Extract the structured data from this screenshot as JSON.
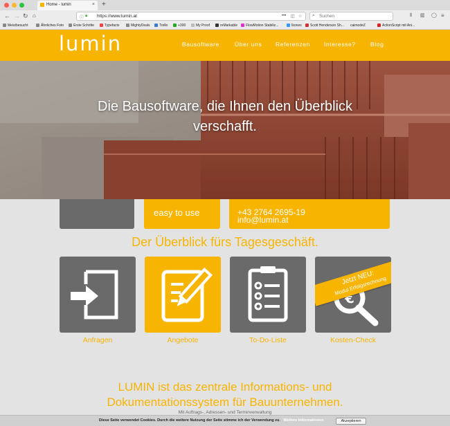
{
  "browser": {
    "tab_title": "Home - lumin",
    "tab_close": "×",
    "new_tab": "+",
    "url": "https://www.lumin.at",
    "search_placeholder": "Suchen",
    "bookmarks": [
      "Meistbesucht",
      "Ähnliches Foto",
      "Erste Schritte",
      "Typefacts",
      "MightyDeals",
      "Trello",
      "+300",
      "My Proof",
      "reMarkable",
      "FlowMotion Stabiliz...",
      "Ikones",
      "Scott Henderson Sh...",
      "caimodeZ",
      "ActionScript mit Ani..."
    ]
  },
  "site": {
    "logo": "lumin",
    "nav": [
      "Bausoftware",
      "Über uns",
      "Referenzen",
      "Interesse?",
      "Blog"
    ],
    "hero_line1": "Die Bausoftware, die Ihnen den Überblick",
    "hero_line2": "verschafft.",
    "strip": {
      "easy": "easy to use",
      "phone": "+43 2764 2695-19",
      "email": "info@lumin.at"
    },
    "section_title": "Der Überblick fürs Tagesgeschäft.",
    "cards": [
      {
        "label": "Anfragen",
        "icon": "sign-in-icon"
      },
      {
        "label": "Angebote",
        "icon": "edit-document-icon"
      },
      {
        "label": "To-Do-Liste",
        "icon": "clipboard-list-icon"
      },
      {
        "label": "Kosten-Check",
        "icon": "euro-search-icon"
      }
    ],
    "ribbon_line1": "Jetzt NEU:",
    "ribbon_line2": "Modul Erfolgsrechnung",
    "lead_line1": "LUMIN ist das zentrale Informations- und",
    "lead_line2": "Dokumentationssystem für Bauunternehmen.",
    "sub_text": "Mit Auftrags-, Adressen- und Terminverwaltung",
    "cookie_text": "Diese Seite verwendet Cookies. Durch die weitere Nutzung der Seite stimme ich der Verwendung zu.",
    "cookie_link": "Weitere Informationen",
    "cookie_accept": "Akzeptieren"
  },
  "colors": {
    "accent": "#f7b400",
    "card_gray": "#6b6a6a",
    "page_bg": "#e3e3e3"
  }
}
